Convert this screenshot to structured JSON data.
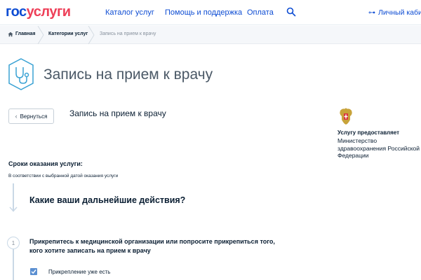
{
  "header": {
    "logo_part1": "гос",
    "logo_part2": "услуги",
    "nav": [
      "Каталог услуг",
      "Помощь и поддержка",
      "Оплата"
    ],
    "account": "Личный кабин"
  },
  "breadcrumbs": [
    "Главная",
    "Категории услуг",
    "Запись на прием к врачу"
  ],
  "page": {
    "title": "Запись на прием к врачу",
    "back_label": "Вернуться",
    "subtitle": "Запись на прием к врачу"
  },
  "provider": {
    "label": "Услугу предоставляет",
    "name": "Министерство здравоохранения Российской Федерации"
  },
  "terms": {
    "title": "Сроки оказания услуги:",
    "text": "В соответствии с выбранной датой оказания услуги"
  },
  "question": "Какие ваши дальнейшие действия?",
  "step": {
    "number": "1",
    "text": "Прикрепитесь к медицинской организации или попросите прикрепиться того, кого хотите записать на прием к врачу",
    "checkbox_label": "Прикрепление уже есть",
    "checked": true
  },
  "colors": {
    "brand_blue": "#0d4cd3",
    "brand_red": "#ee3f58",
    "checkbox": "#5b8fd1",
    "title_icon": "#3aa2d4"
  }
}
